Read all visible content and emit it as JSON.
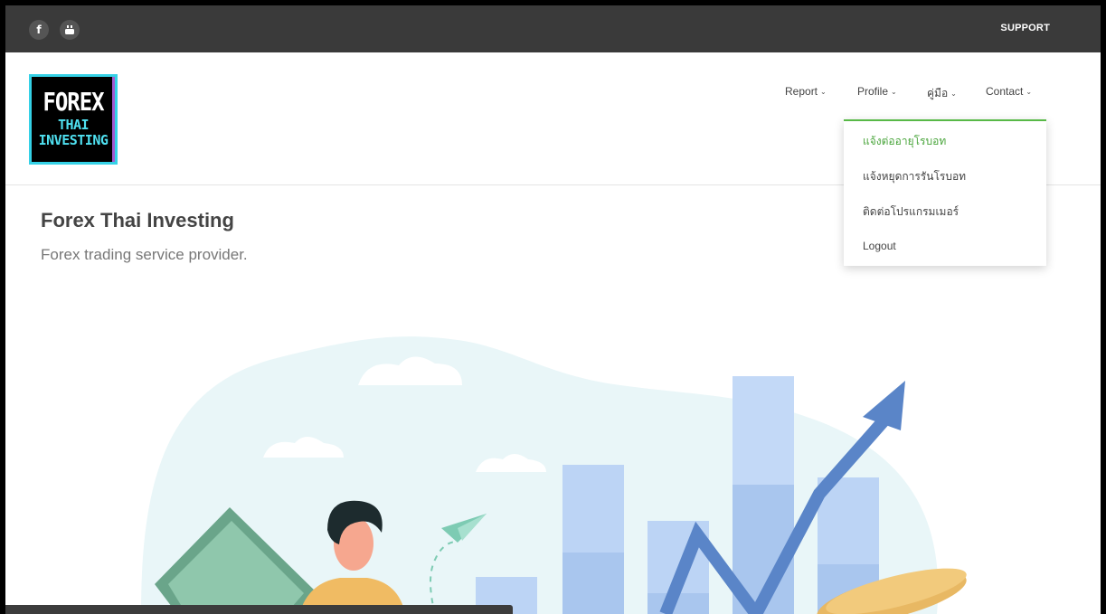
{
  "topbar": {
    "icons": [
      "facebook-icon",
      "youtube-icon"
    ],
    "facebook_glyph": "f",
    "support_label": "SUPPORT"
  },
  "logo": {
    "line1": "FOREX",
    "line2": "THAI",
    "line3": "INVESTING"
  },
  "nav": {
    "items": [
      {
        "label": "Report",
        "chevron": "⌄"
      },
      {
        "label": "Profile",
        "chevron": "⌄"
      },
      {
        "label": "คู่มือ",
        "chevron": "⌄"
      },
      {
        "label": "Contact",
        "chevron": "⌄"
      }
    ]
  },
  "dropdown": {
    "items": [
      {
        "label": "แจ้งต่ออายุโรบอท",
        "active": true
      },
      {
        "label": "แจ้งหยุดการรันโรบอท",
        "active": false
      },
      {
        "label": "ติดต่อโปรแกรมเมอร์",
        "active": false
      },
      {
        "label": "Logout",
        "active": false
      }
    ]
  },
  "hero": {
    "title": "Forex Thai Investing",
    "subtitle": "Forex trading service provider."
  },
  "colors": {
    "topbar": "#3a3a3a",
    "accent_green": "#58b947",
    "logo_border": "#35d1e6",
    "chart_blue": "#a9c8f0",
    "arrow_blue": "#5a85c8"
  }
}
